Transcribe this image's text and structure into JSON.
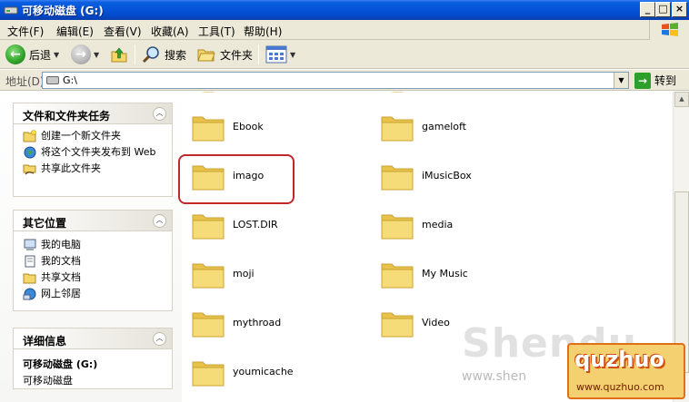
{
  "window": {
    "title": "可移动磁盘 (G:)"
  },
  "menu": {
    "items": [
      "文件(F)",
      "编辑(E)",
      "查看(V)",
      "收藏(A)",
      "工具(T)",
      "帮助(H)"
    ]
  },
  "toolbar": {
    "back_label": "后退",
    "search_label": "搜索",
    "folders_label": "文件夹"
  },
  "address": {
    "label": "地址(D)",
    "value": "G:\\",
    "go_label": "转到"
  },
  "tasks": {
    "file_tasks": {
      "title": "文件和文件夹任务",
      "items": [
        "创建一个新文件夹",
        "将这个文件夹发布到 Web",
        "共享此文件夹"
      ]
    },
    "other_places": {
      "title": "其它位置",
      "items": [
        "我的电脑",
        "我的文档",
        "共享文档",
        "网上邻居"
      ]
    },
    "details": {
      "title": "详细信息",
      "name": "可移动磁盘 (G:)",
      "type": "可移动磁盘"
    }
  },
  "folders": [
    {
      "name": "Ebook"
    },
    {
      "name": "gameloft"
    },
    {
      "name": "imago"
    },
    {
      "name": "iMusicBox"
    },
    {
      "name": "LOST.DIR"
    },
    {
      "name": "media"
    },
    {
      "name": "moji"
    },
    {
      "name": "My Music"
    },
    {
      "name": "mythroad"
    },
    {
      "name": "Video"
    },
    {
      "name": "youmicache"
    }
  ],
  "selected_folder": "imago",
  "watermark": {
    "brand": "Shendu",
    "url": "www.shen",
    "badge_title": "quzhuo",
    "badge_url": "www.quzhuo.com"
  },
  "colors": {
    "titlebar": "#0453d8",
    "highlight_ring": "#c0282c",
    "folder_fill": "#f4d66b"
  }
}
